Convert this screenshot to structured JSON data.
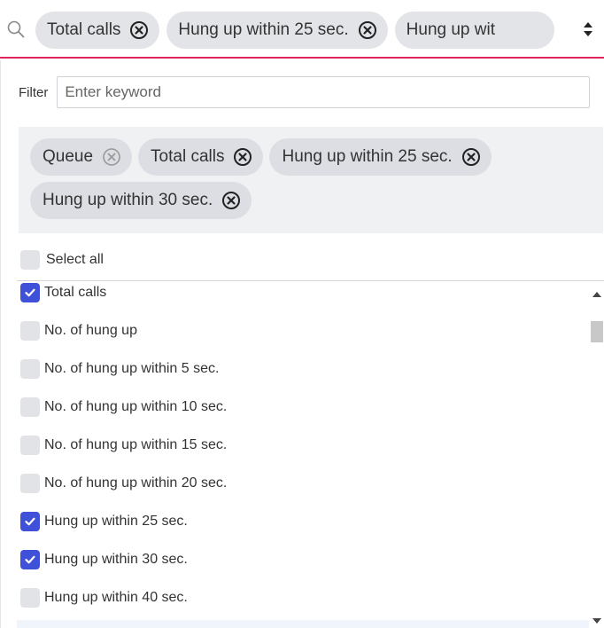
{
  "select_bar": {
    "tags": [
      {
        "label": "Total calls"
      },
      {
        "label": "Hung up within 25 sec."
      },
      {
        "label": "Hung up wit"
      }
    ]
  },
  "filter": {
    "label": "Filter",
    "placeholder": "Enter keyword"
  },
  "selected": {
    "tags": [
      {
        "label": "Queue",
        "removable_style": "light"
      },
      {
        "label": "Total calls",
        "removable_style": "dark"
      },
      {
        "label": "Hung up within 25 sec.",
        "removable_style": "dark"
      },
      {
        "label": "Hung up within 30 sec.",
        "removable_style": "dark"
      }
    ]
  },
  "select_all": {
    "label": "Select all",
    "checked": false
  },
  "options": [
    {
      "label": "Total calls",
      "checked": true
    },
    {
      "label": "No. of hung up",
      "checked": false
    },
    {
      "label": "No. of hung up within 5 sec.",
      "checked": false
    },
    {
      "label": "No. of hung up within 10 sec.",
      "checked": false
    },
    {
      "label": "No. of hung up within 15 sec.",
      "checked": false
    },
    {
      "label": "No. of hung up within 20 sec.",
      "checked": false
    },
    {
      "label": "Hung up within 25 sec.",
      "checked": true
    },
    {
      "label": "Hung up within 30 sec.",
      "checked": true
    },
    {
      "label": "Hung up within 40 sec.",
      "checked": false
    }
  ],
  "colors": {
    "accent_underline": "#e0245e",
    "checkbox_checked": "#3f51d8",
    "checkbox_unchecked": "#e2e3e7",
    "tag_bg": "#e3e4e8"
  },
  "icons": {
    "search": "search-icon",
    "remove": "close-circle-icon",
    "sort": "sort-arrows-icon",
    "check": "check-icon"
  }
}
